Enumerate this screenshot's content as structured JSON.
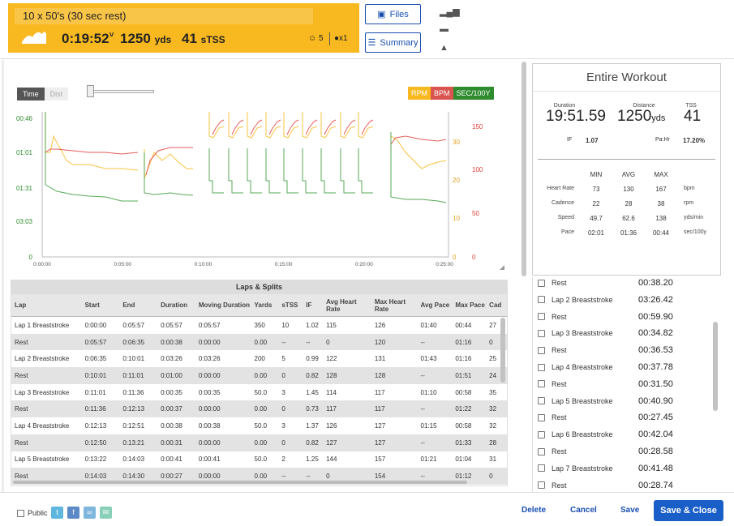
{
  "header": {
    "title": "10 x 50's (30 sec rest)",
    "duration": "0:19:52",
    "distance": "1250",
    "distance_unit": "yds",
    "tss": "41",
    "tss_unit": "sTSS",
    "feel_count": "5",
    "comment_count": "x1",
    "files_label": "Files",
    "summary_label": "Summary",
    "brand_color": "#f8b920"
  },
  "chart_controls": {
    "time_label": "Time",
    "dist_label": "Dist",
    "legend": [
      "RPM",
      "BPM",
      "SEC/100Y"
    ]
  },
  "chart_data": {
    "type": "line",
    "x_ticks": [
      "0:00:00",
      "0:05:00",
      "0:10:00",
      "0:15:00",
      "0:20:00",
      "0:25:00"
    ],
    "y_left_ticks": [
      "00:46",
      "01:01",
      "01:31",
      "03:03",
      "0"
    ],
    "y_mid_ticks": [
      "30",
      "20",
      "10",
      "0"
    ],
    "y_right_ticks": [
      "150",
      "100",
      "50",
      "0"
    ],
    "series": [
      {
        "name": "RPM",
        "color": "#f8b920"
      },
      {
        "name": "BPM",
        "color": "#e0413c"
      },
      {
        "name": "SEC/100Y",
        "color": "#3a9a3a"
      }
    ]
  },
  "laps": {
    "caption": "Laps & Splits",
    "columns": [
      "Lap",
      "Start",
      "End",
      "Duration",
      "Moving Duration",
      "Yards",
      "sTSS",
      "IF",
      "Avg Heart Rate",
      "Max Heart Rate",
      "Avg Pace",
      "Max Pace",
      "Cad"
    ],
    "rows": [
      [
        "Lap 1 Breaststroke",
        "0:00:00",
        "0:05:57",
        "0:05:57",
        "0:05:57",
        "350",
        "10",
        "1.02",
        "115",
        "126",
        "01:40",
        "00:44",
        "27"
      ],
      [
        "Rest",
        "0:05:57",
        "0:06:35",
        "0:00:38",
        "0:00:00",
        "0.00",
        "--",
        "--",
        "0",
        "120",
        "--",
        "01:16",
        "0"
      ],
      [
        "Lap 2 Breaststroke",
        "0:06:35",
        "0:10:01",
        "0:03:26",
        "0:03:26",
        "200",
        "5",
        "0.99",
        "122",
        "131",
        "01:43",
        "01:16",
        "25"
      ],
      [
        "Rest",
        "0:10:01",
        "0:11:01",
        "0:01:00",
        "0:00:00",
        "0.00",
        "0",
        "0.82",
        "128",
        "128",
        "--",
        "01:51",
        "24"
      ],
      [
        "Lap 3 Breaststroke",
        "0:11:01",
        "0:11:36",
        "0:00:35",
        "0:00:35",
        "50.0",
        "3",
        "1.45",
        "114",
        "117",
        "01:10",
        "00:58",
        "35"
      ],
      [
        "Rest",
        "0:11:36",
        "0:12:13",
        "0:00:37",
        "0:00:00",
        "0.00",
        "0",
        "0.73",
        "117",
        "117",
        "--",
        "01:22",
        "32"
      ],
      [
        "Lap 4 Breaststroke",
        "0:12:13",
        "0:12:51",
        "0:00:38",
        "0:00:38",
        "50.0",
        "3",
        "1.37",
        "126",
        "127",
        "01:15",
        "00:58",
        "32"
      ],
      [
        "Rest",
        "0:12:50",
        "0:13:21",
        "0:00:31",
        "0:00:00",
        "0.00",
        "0",
        "0.82",
        "127",
        "127",
        "--",
        "01:33",
        "28"
      ],
      [
        "Lap 5 Breaststroke",
        "0:13:22",
        "0:14:03",
        "0:00:41",
        "0:00:41",
        "50.0",
        "2",
        "1.25",
        "144",
        "157",
        "01:21",
        "01:04",
        "31"
      ],
      [
        "Rest",
        "0:14:03",
        "0:14:30",
        "0:00:27",
        "0:00:00",
        "0.00",
        "--",
        "--",
        "0",
        "154",
        "--",
        "01:12",
        "0"
      ]
    ]
  },
  "summary": {
    "title": "Entire Workout",
    "duration_label": "Duration",
    "duration": "19:51.59",
    "distance_label": "Distance",
    "distance": "1250",
    "distance_unit": "yds",
    "tss_label": "TSS",
    "tss": "41",
    "if_label": "IF",
    "if": "1.07",
    "pahr_label": "Pa:Hr",
    "pahr": "17.20%",
    "grid_headers": [
      "MIN",
      "AVG",
      "MAX"
    ],
    "grid_rows": [
      {
        "label": "Heart Rate",
        "min": "73",
        "avg": "130",
        "max": "167",
        "unit": "bpm"
      },
      {
        "label": "Cadence",
        "min": "22",
        "avg": "28",
        "max": "38",
        "unit": "rpm"
      },
      {
        "label": "Speed",
        "min": "49.7",
        "avg": "62.6",
        "max": "138",
        "unit": "yds/min"
      },
      {
        "label": "Pace",
        "min": "02:01",
        "avg": "01:36",
        "max": "00:44",
        "unit": "sec/100y"
      }
    ]
  },
  "intervals": [
    {
      "label": "Rest",
      "time": "00:38.20"
    },
    {
      "label": "Lap 2 Breaststroke",
      "time": "03:26.42"
    },
    {
      "label": "Rest",
      "time": "00:59.90"
    },
    {
      "label": "Lap 3 Breaststroke",
      "time": "00:34.82"
    },
    {
      "label": "Rest",
      "time": "00:36.53"
    },
    {
      "label": "Lap 4 Breaststroke",
      "time": "00:37.78"
    },
    {
      "label": "Rest",
      "time": "00:31.50"
    },
    {
      "label": "Lap 5 Breaststroke",
      "time": "00:40.90"
    },
    {
      "label": "Rest",
      "time": "00:27.45"
    },
    {
      "label": "Lap 6 Breaststroke",
      "time": "00:42.04"
    },
    {
      "label": "Rest",
      "time": "00:28.58"
    },
    {
      "label": "Lap 7 Breaststroke",
      "time": "00:41.48"
    },
    {
      "label": "Rest",
      "time": "00:28.74"
    }
  ],
  "footer": {
    "public_label": "Public",
    "delete_label": "Delete",
    "cancel_label": "Cancel",
    "save_label": "Save",
    "save_close_label": "Save & Close"
  }
}
